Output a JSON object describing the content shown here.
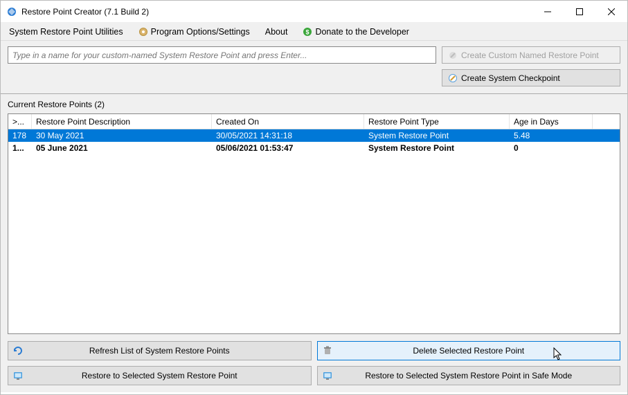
{
  "window": {
    "title": "Restore Point Creator (7.1 Build 2)"
  },
  "menu": {
    "utilities": "System Restore Point Utilities",
    "options": "Program Options/Settings",
    "about": "About",
    "donate": "Donate to the Developer"
  },
  "toolbar": {
    "input_placeholder": "Type in a name for your custom-named System Restore Point and press Enter...",
    "create_custom": "Create Custom Named Restore Point",
    "create_checkpoint": "Create System Checkpoint"
  },
  "list_label": "Current Restore Points (2)",
  "columns": {
    "idx": ">...",
    "desc": "Restore Point Description",
    "created": "Created On",
    "type": "Restore Point Type",
    "age": "Age in Days"
  },
  "rows": [
    {
      "idx": "178",
      "desc": "30 May 2021",
      "created": "30/05/2021 14:31:18",
      "type": "System Restore Point",
      "age": "5.48",
      "selected": true,
      "bold": false
    },
    {
      "idx": "1...",
      "desc": "05 June 2021",
      "created": "05/06/2021 01:53:47",
      "type": "System Restore Point",
      "age": "0",
      "selected": false,
      "bold": true
    }
  ],
  "buttons": {
    "refresh": "Refresh List of System Restore Points",
    "delete": "Delete Selected Restore Point",
    "restore": "Restore to Selected System Restore Point",
    "restore_safe": "Restore to Selected System Restore Point in Safe Mode"
  }
}
